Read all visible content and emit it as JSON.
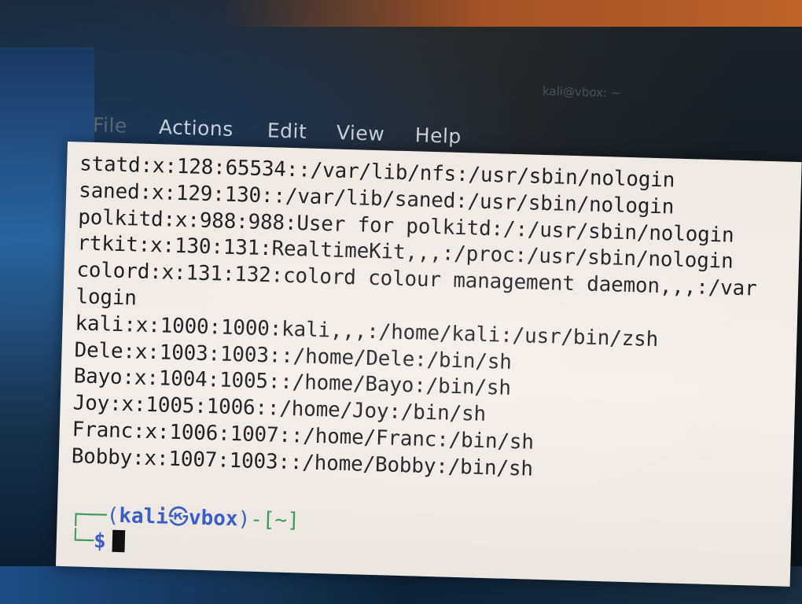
{
  "window": {
    "title": "kali@vbox: ~"
  },
  "menu": {
    "items": [
      "File",
      "Actions",
      "Edit",
      "View",
      "Help"
    ]
  },
  "terminal": {
    "lines": [
      "statd:x:128:65534::/var/lib/nfs:/usr/sbin/nologin",
      "saned:x:129:130::/var/lib/saned:/usr/sbin/nologin",
      "polkitd:x:988:988:User for polkitd:/:/usr/sbin/nologin",
      "rtkit:x:130:131:RealtimeKit,,,:/proc:/usr/sbin/nologin",
      "colord:x:131:132:colord colour management daemon,,,:/var",
      "login",
      "kali:x:1000:1000:kali,,,:/home/kali:/usr/bin/zsh",
      "Dele:x:1003:1003::/home/Dele:/bin/sh",
      "Bayo:x:1004:1005::/home/Bayo:/bin/sh",
      "Joy:x:1005:1006::/home/Joy:/bin/sh",
      "Franc:x:1006:1007::/home/Franc:/bin/sh",
      "Bobby:x:1007:1003::/home/Bobby:/bin/sh"
    ],
    "prompt": {
      "user": "kali",
      "at_symbol": "㉿",
      "host": "vbox",
      "cwd": "~",
      "symbol": "$"
    }
  }
}
